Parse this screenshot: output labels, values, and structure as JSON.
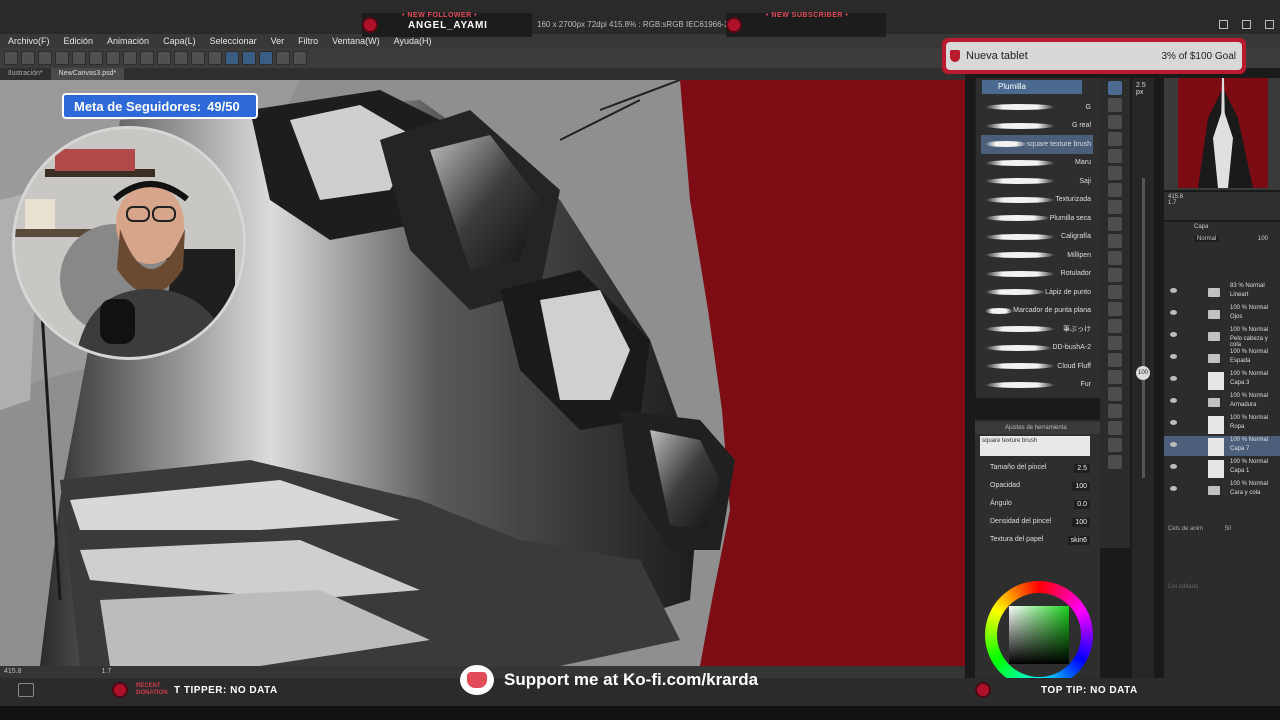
{
  "menu": [
    "Archivo(F)",
    "Edición",
    "Animación",
    "Capa(L)",
    "Seleccionar",
    "Ver",
    "Filtro",
    "Ventana(W)",
    "Ayuda(H)"
  ],
  "doc_tabs": [
    "Ilustración*",
    "NewCanvas3.psd*"
  ],
  "doc_info": "160 x 2700px 72dpi 415.8% : RGB:sRGB IEC61966-2.1)",
  "alerts": {
    "follower_title": "• NEW FOLLOWER •",
    "follower_name": "ANGEL_AYAMI",
    "subscriber_title": "• NEW SUBSCRIBER •"
  },
  "goal": {
    "label": "Nueva tablet",
    "progress": "3% of $100 Goal"
  },
  "meta": {
    "label": "Meta de Seguidores:",
    "value": "49/50"
  },
  "status": {
    "zoom": "415.8",
    "angle": "1.7"
  },
  "tipper": {
    "small": "RECENT DONATION",
    "label": "T TIPPER: NO DATA"
  },
  "kofi": {
    "text": "Support me at Ko-fi.com/krarda"
  },
  "toptip": {
    "label": "TOP TIP: NO DATA"
  },
  "brush_panel": {
    "title": "Plumilla",
    "brushes": [
      "G",
      "G real",
      "square texture brush",
      "Maru",
      "Saji",
      "Texturizada",
      "Plumilla seca",
      "Caligrafía",
      "Millipen",
      "Rotulador",
      "Lápiz de punto",
      "Marcador de punta plana",
      "筆ぶっけ",
      "DD-bushA-2",
      "Cloud Fluff",
      "Fur"
    ],
    "selected_index": 2
  },
  "size_slider": {
    "size": "2.5",
    "unit": "px",
    "opacity": "100"
  },
  "tool_settings": {
    "header": "Ajustes de herramienta",
    "brush_name": "square texture brush",
    "props": [
      {
        "label": "Tamaño del pincel",
        "value": "2.5"
      },
      {
        "label": "Opacidad",
        "value": "100"
      },
      {
        "label": "Ángulo",
        "value": "0.0"
      },
      {
        "label": "Densidad del pincel",
        "value": "100"
      },
      {
        "label": "Textura del papel",
        "value": "skin6"
      }
    ]
  },
  "navigator": {
    "zoom": "415.8",
    "angle": "1.7"
  },
  "layer_panel": {
    "title": "Capa",
    "blend": "Normal",
    "opacity": "100",
    "layers": [
      {
        "t1": "83 % Normal",
        "t2": "Lineart",
        "kind": "folder"
      },
      {
        "t1": "100 % Normal",
        "t2": "Ojos",
        "kind": "folder"
      },
      {
        "t1": "100 % Normal",
        "t2": "Pelo cabeza y cola",
        "kind": "folder"
      },
      {
        "t1": "100 % Normal",
        "t2": "Espada",
        "kind": "folder"
      },
      {
        "t1": "100 % Normal",
        "t2": "Capa 3",
        "kind": "layer"
      },
      {
        "t1": "100 % Normal",
        "t2": "Armadura",
        "kind": "folder"
      },
      {
        "t1": "100 % Normal",
        "t2": "Ropa",
        "kind": "layer"
      },
      {
        "t1": "100 % Normal",
        "t2": "Capa 7",
        "kind": "layer"
      },
      {
        "t1": "100 % Normal",
        "t2": "Capa 1",
        "kind": "layer"
      },
      {
        "t1": "100 % Normal",
        "t2": "Cara y cola",
        "kind": "folder"
      }
    ],
    "selected_index": 7
  },
  "cel_panel": {
    "label": "Cels de anim",
    "value": "50",
    "footer": "Cel editado"
  },
  "colors": {
    "canvas_red": "#7d0c14",
    "accent_blue": "#2d69d8",
    "alert_red": "#b81b2e"
  }
}
